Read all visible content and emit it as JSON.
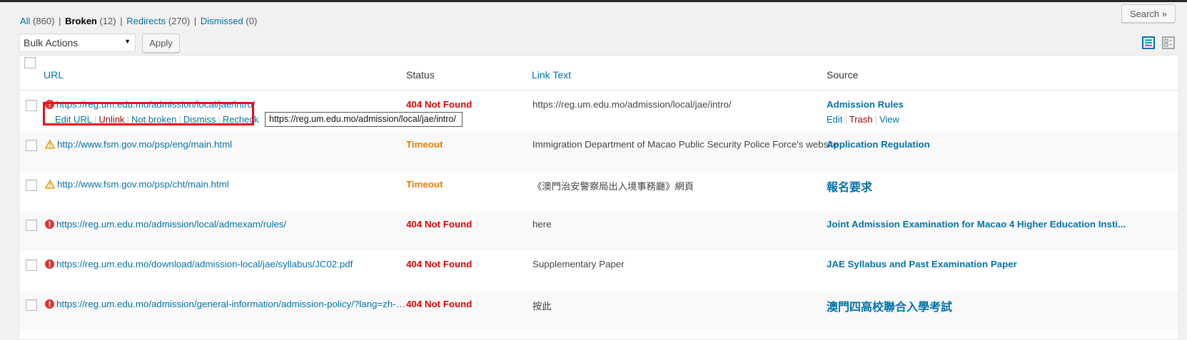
{
  "filters": {
    "all": {
      "label": "All",
      "count": "(860)"
    },
    "broken": {
      "label": "Broken",
      "count": "(12)"
    },
    "redirects": {
      "label": "Redirects",
      "count": "(270)"
    },
    "dismissed": {
      "label": "Dismissed",
      "count": "(0)"
    }
  },
  "search_button": "Search »",
  "bulk_actions": {
    "selected": "Bulk Actions",
    "apply_label": "Apply"
  },
  "table": {
    "headers": {
      "url": "URL",
      "status": "Status",
      "link_text": "Link Text",
      "source": "Source"
    },
    "rows": [
      {
        "url": "https://reg.um.edu.mo/admission/local/jae/intro/",
        "status": "404 Not Found",
        "link_text": "https://reg.um.edu.mo/admission/local/jae/intro/",
        "source": "Admission Rules"
      },
      {
        "url": "http://www.fsm.gov.mo/psp/eng/main.html",
        "status": "Timeout",
        "link_text": "Immigration Department of Macao Public Security Police Force's website",
        "source": "Application Regulation"
      },
      {
        "url": "http://www.fsm.gov.mo/psp/cht/main.html",
        "status": "Timeout",
        "link_text": "《澳門治安警察局出入境事務廳》網頁",
        "source": "報名要求"
      },
      {
        "url": "https://reg.um.edu.mo/admission/local/admexam/rules/",
        "status": "404 Not Found",
        "link_text": "here",
        "source": "Joint Admission Examination for Macao 4 Higher Education Insti..."
      },
      {
        "url": "https://reg.um.edu.mo/download/admission-local/jae/syllabus/JC02.pdf",
        "status": "404 Not Found",
        "link_text": "Supplementary Paper",
        "source": "JAE Syllabus and Past Examination Paper"
      },
      {
        "url": "https://reg.um.edu.mo/admission/general-information/admission-policy/?lang=zh-ha...",
        "status": "404 Not Found",
        "link_text": "按此",
        "source": "澳門四高校聯合入學考試"
      }
    ]
  },
  "row_actions": {
    "edit_url": "Edit URL",
    "unlink": "Unlink",
    "not_broken": "Not broken",
    "dismiss": "Dismiss",
    "recheck": "Recheck"
  },
  "source_actions": {
    "edit": "Edit",
    "trash": "Trash",
    "view": "View"
  },
  "tooltip": "https://reg.um.edu.mo/admission/local/jae/intro/",
  "icons": {
    "error": "error-circle-icon",
    "warning": "warning-triangle-icon",
    "list_view": "list-view-icon",
    "excerpt_view": "excerpt-view-icon"
  },
  "colors": {
    "link": "#0073aa",
    "error": "#e00000",
    "timeout": "#ee7d00",
    "highlight": "#e8101c"
  }
}
